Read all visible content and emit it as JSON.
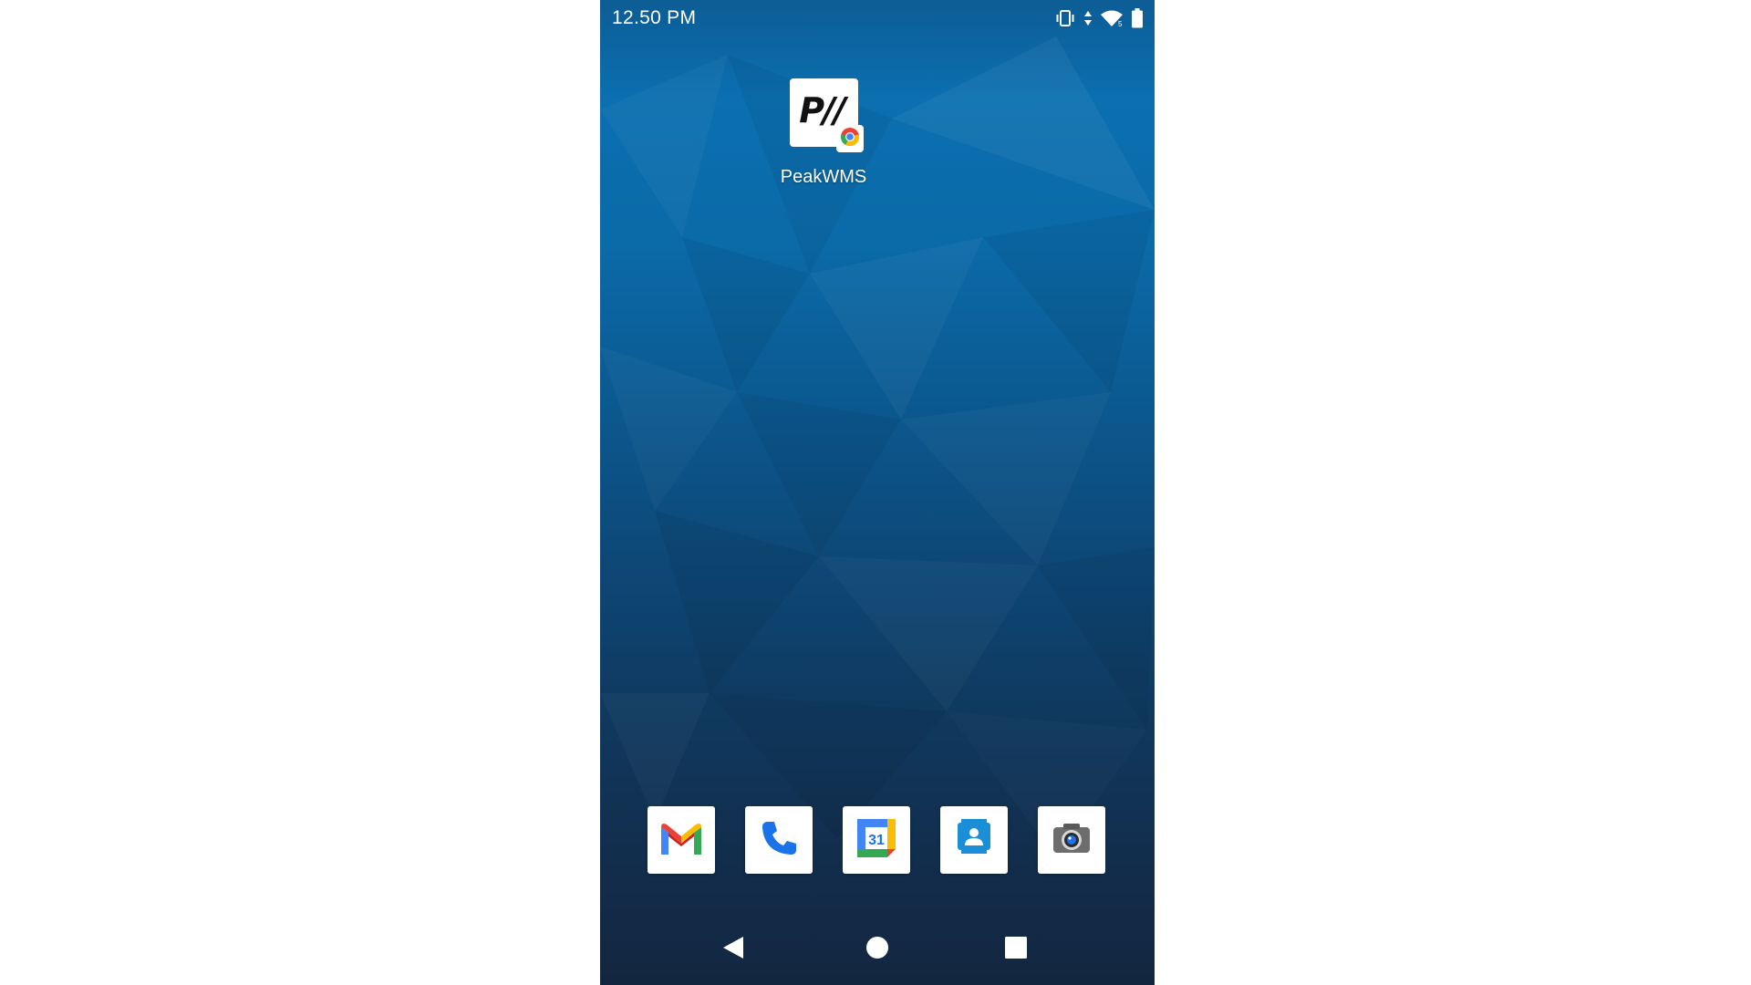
{
  "status_bar": {
    "time": "12.50 PM",
    "icons": [
      "vibrate-icon",
      "data-arrows-icon",
      "wifi-icon",
      "battery-icon"
    ]
  },
  "home": {
    "shortcuts": [
      {
        "label": "PeakWMS",
        "icon_text": "P//",
        "badge_icon": "chrome-icon"
      }
    ]
  },
  "dock": {
    "apps": [
      {
        "name": "gmail",
        "icon": "gmail-icon"
      },
      {
        "name": "phone",
        "icon": "phone-icon"
      },
      {
        "name": "calendar",
        "icon": "calendar-icon",
        "icon_text": "31"
      },
      {
        "name": "contacts",
        "icon": "contacts-icon"
      },
      {
        "name": "camera",
        "icon": "camera-icon"
      }
    ]
  },
  "nav_bar": {
    "buttons": [
      "back-icon",
      "home-icon",
      "recents-icon"
    ]
  },
  "colors": {
    "wallpaper_top": "#0b6fb0",
    "wallpaper_bottom": "#13263f",
    "google_blue": "#4285F4",
    "google_red": "#EA4335",
    "google_yellow": "#FBBC04",
    "google_green": "#34A853"
  }
}
